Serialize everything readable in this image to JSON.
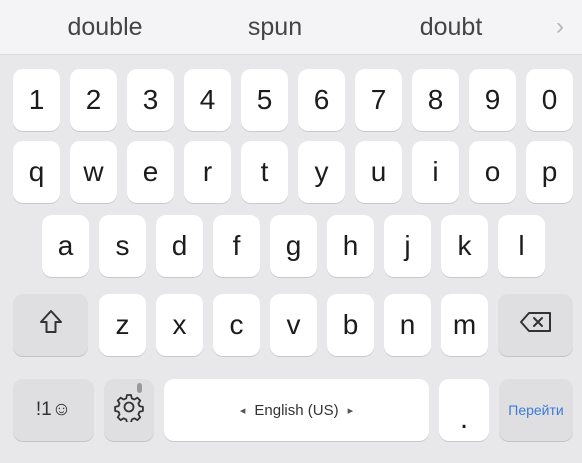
{
  "suggestions": [
    "double",
    "spun",
    "doubt"
  ],
  "suggestion_more_glyph": "›",
  "keys": {
    "numbers": [
      "1",
      "2",
      "3",
      "4",
      "5",
      "6",
      "7",
      "8",
      "9",
      "0"
    ],
    "row1": [
      "q",
      "w",
      "e",
      "r",
      "t",
      "y",
      "u",
      "i",
      "o",
      "p"
    ],
    "row2": [
      "a",
      "s",
      "d",
      "f",
      "g",
      "h",
      "j",
      "k",
      "l"
    ],
    "row3": [
      "z",
      "x",
      "c",
      "v",
      "b",
      "n",
      "m"
    ]
  },
  "bottom": {
    "symbols_label": "!1☺",
    "settings_icon": "gear-icon",
    "space_label": "English (US)",
    "space_left_glyph": "◂",
    "space_right_glyph": "▸",
    "period": ".",
    "action_label": "Перейти"
  },
  "icons": {
    "shift": "shift-icon",
    "backspace": "backspace-icon"
  },
  "colors": {
    "background": "#e8e8ea",
    "key": "#ffffff",
    "function_key": "#dfdfe2",
    "action_text": "#3c7bd6"
  }
}
